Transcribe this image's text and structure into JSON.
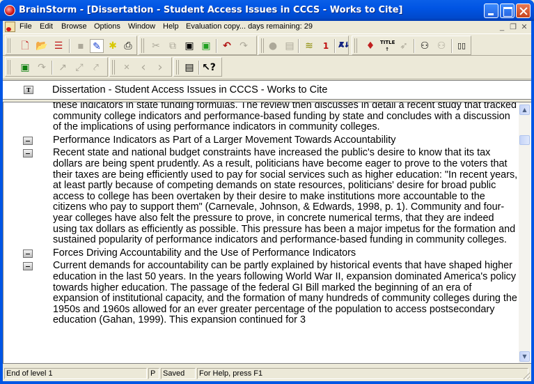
{
  "window": {
    "title": "BrainStorm - [Dissertation - Student Access Issues in CCCS - Works to Cite]"
  },
  "menubar": {
    "items": [
      "File",
      "Edit",
      "Browse",
      "Options",
      "Window",
      "Help"
    ],
    "eval_notice": "Evaluation copy... days remaining: 29"
  },
  "toolbar": {
    "row1": {
      "group1": [
        {
          "icon": "new-stack-icon",
          "glyph": "🗋",
          "enabled": true
        },
        {
          "icon": "open-folder-icon",
          "glyph": "📂",
          "enabled": true
        },
        {
          "icon": "brain-stack-icon",
          "glyph": "☰",
          "enabled": true
        },
        {
          "icon": "save-icon",
          "glyph": "💾",
          "enabled": false
        },
        {
          "icon": "edit-pen-icon",
          "glyph": "✎",
          "enabled": true
        },
        {
          "icon": "web-icon",
          "glyph": "✱",
          "enabled": true
        },
        {
          "icon": "print-icon",
          "glyph": "⎙",
          "enabled": true
        }
      ],
      "group2": [
        {
          "icon": "cut-icon",
          "glyph": "✂",
          "enabled": false
        },
        {
          "icon": "copy-icon",
          "glyph": "⧉",
          "enabled": false
        },
        {
          "icon": "paste-icon",
          "glyph": "📋",
          "enabled": true
        },
        {
          "icon": "paste-special-icon",
          "glyph": "📋",
          "enabled": true
        },
        {
          "icon": "undo-icon",
          "glyph": "↶",
          "enabled": true
        },
        {
          "icon": "redo-icon",
          "glyph": "↷",
          "enabled": false
        }
      ],
      "group3": [
        {
          "icon": "brain-icon",
          "glyph": "●",
          "enabled": false
        },
        {
          "icon": "note-edit-icon",
          "glyph": "▤",
          "enabled": false
        },
        {
          "icon": "separator-lines-icon",
          "glyph": "≋",
          "enabled": true
        },
        {
          "icon": "numbered-icon",
          "glyph": "1",
          "enabled": true
        },
        {
          "icon": "sort-az-icon",
          "glyph": "A↓",
          "enabled": true
        },
        {
          "icon": "sort-za-icon",
          "glyph": "Z↓",
          "enabled": true
        }
      ],
      "group4": [
        {
          "icon": "balloon-icon",
          "glyph": "♦",
          "enabled": true
        },
        {
          "icon": "title-up-icon",
          "glyph": "TITLE",
          "enabled": true
        },
        {
          "icon": "rocket-icon",
          "glyph": "➶",
          "enabled": false
        },
        {
          "icon": "binoculars-icon",
          "glyph": "⚇",
          "enabled": true
        },
        {
          "icon": "binoculars-next-icon",
          "glyph": "⚇",
          "enabled": false
        },
        {
          "icon": "two-pane-icon",
          "glyph": "▯▯",
          "enabled": true
        }
      ]
    },
    "row2": {
      "group1": [
        {
          "icon": "green-box-icon",
          "glyph": "▣",
          "enabled": true
        },
        {
          "icon": "jump-icon",
          "glyph": "↷",
          "enabled": false
        },
        {
          "icon": "arrow-up-right-icon",
          "glyph": "↗",
          "enabled": false
        },
        {
          "icon": "arrow-both-icon",
          "glyph": "⤢",
          "enabled": false
        },
        {
          "icon": "arrow-link-icon",
          "glyph": "⤤",
          "enabled": false
        }
      ],
      "group2": [
        {
          "icon": "delete-link-icon",
          "glyph": "✕",
          "enabled": false
        },
        {
          "icon": "back-icon",
          "glyph": "‹",
          "enabled": false
        },
        {
          "icon": "forward-icon",
          "glyph": "›",
          "enabled": false
        }
      ],
      "group3": [
        {
          "icon": "properties-icon",
          "glyph": "▤",
          "enabled": true
        },
        {
          "icon": "context-help-icon",
          "glyph": "↖?",
          "enabled": true
        }
      ]
    }
  },
  "header": {
    "level_badge": "T",
    "title": "Dissertation - Student Access Issues in CCCS - Works to Cite"
  },
  "outline": {
    "nodes": [
      {
        "has_button": false,
        "text": "these indicators in state funding formulas. The review then discusses in detail a recent study that tracked community college indicators and performance-based funding by state and concludes with a discussion of the implications of using performance indicators in community colleges."
      },
      {
        "has_button": true,
        "text": "Performance Indicators as Part of a Larger Movement Towards Accountability"
      },
      {
        "has_button": true,
        "text": "Recent state and national budget constraints have increased the public's desire to know that its tax dollars are being spent prudently. As a result, politicians have become eager to prove to the voters that their taxes are being efficiently used to pay for social services such as higher education: \"In recent years, at least partly because of competing demands on state resources, politicians' desire for broad public access to college has been overtaken by their desire to make institutions more accountable to the citizens who pay to support them\" (Carnevale, Johnson, & Edwards, 1998, p. 1). Community and four-year colleges have also felt the pressure to prove, in concrete numerical terms, that they are indeed using tax dollars as efficiently as possible. This pressure has been a major impetus for the formation and sustained popularity of performance indicators and performance-based funding in community colleges."
      },
      {
        "has_button": true,
        "text": "Forces Driving Accountability and the Use of Performance Indicators"
      },
      {
        "has_button": true,
        "text": "Current demands for accountability can be partly explained by historical events that have shaped higher education in the last 50 years. In the years following World War II, expansion dominated America's policy towards higher education. The passage of the federal GI Bill marked the beginning of an era of expansion of institutional capacity, and the formation of many hundreds of community colleges during the 1950s and 1960s allowed for an ever greater percentage of the population to access postsecondary education (Gahan, 1999). This expansion continued for 3"
      }
    ]
  },
  "statusbar": {
    "position": "End of level 1",
    "mode": "P",
    "save_state": "Saved",
    "help": "For Help, press F1"
  }
}
